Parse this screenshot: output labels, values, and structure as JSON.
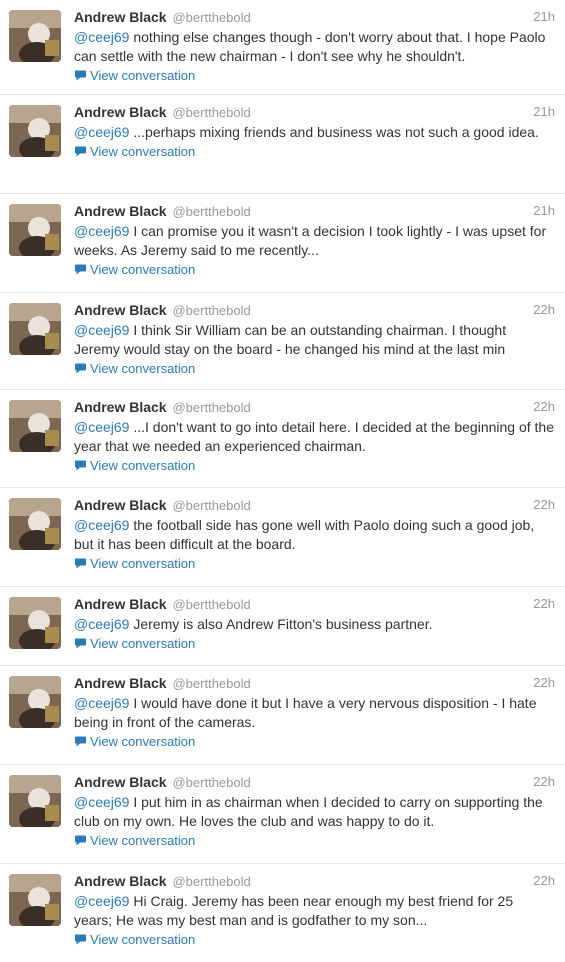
{
  "tweets": [
    {
      "name": "Andrew Black",
      "handle": "@bertthebold",
      "time": "21h",
      "mention": "@ceej69",
      "text": " nothing else changes though - don't worry about that. I hope Paolo can settle with the new chairman - I don't see why he shouldn't.",
      "view_conversation": "View conversation"
    },
    {
      "name": "Andrew Black",
      "handle": "@bertthebold",
      "time": "21h",
      "mention": "@ceej69",
      "text": " ...perhaps mixing friends and business was not such a good idea.",
      "view_conversation": "View conversation"
    },
    {
      "name": "Andrew Black",
      "handle": "@bertthebold",
      "time": "21h",
      "mention": "@ceej69",
      "text": " I can promise you it wasn't a decision I took lightly - I was upset for weeks. As Jeremy said to me recently...",
      "view_conversation": "View conversation"
    },
    {
      "name": "Andrew Black",
      "handle": "@bertthebold",
      "time": "22h",
      "mention": "@ceej69",
      "text": " I think Sir William can be an outstanding chairman. I thought Jeremy would stay on the board - he changed his mind at the last min",
      "view_conversation": "View conversation"
    },
    {
      "name": "Andrew Black",
      "handle": "@bertthebold",
      "time": "22h",
      "mention": "@ceej69",
      "text": " ...I don't want to go into detail here. I decided at the beginning of the year that we needed an experienced chairman.",
      "view_conversation": "View conversation"
    },
    {
      "name": "Andrew Black",
      "handle": "@bertthebold",
      "time": "22h",
      "mention": "@ceej69",
      "text": " the football side has gone well with Paolo doing such a good job, but it has been difficult at the board.",
      "view_conversation": "View conversation"
    },
    {
      "name": "Andrew Black",
      "handle": "@bertthebold",
      "time": "22h",
      "mention": "@ceej69",
      "text": " Jeremy is also Andrew Fitton's business partner.",
      "view_conversation": "View conversation"
    },
    {
      "name": "Andrew Black",
      "handle": "@bertthebold",
      "time": "22h",
      "mention": "@ceej69",
      "text": " I would have done it but I have a very nervous disposition - I hate being in front of the cameras.",
      "view_conversation": "View conversation"
    },
    {
      "name": "Andrew Black",
      "handle": "@bertthebold",
      "time": "22h",
      "mention": "@ceej69",
      "text": " I put him in as chairman when I decided to carry on supporting the club on my own. He loves the club and was happy to do it.",
      "view_conversation": "View conversation"
    },
    {
      "name": "Andrew Black",
      "handle": "@bertthebold",
      "time": "22h",
      "mention": "@ceej69",
      "text": " Hi Craig. Jeremy has been near enough my best friend for 25 years; He was my best man and is godfather to my son...",
      "view_conversation": "View conversation"
    }
  ],
  "colors": {
    "link": "#2b7bb9",
    "muted": "#999999",
    "text": "#333333",
    "divider": "#e8e8e8"
  },
  "icons": {
    "avatar": "avatar-photo",
    "conversation": "speech-bubble-icon"
  }
}
